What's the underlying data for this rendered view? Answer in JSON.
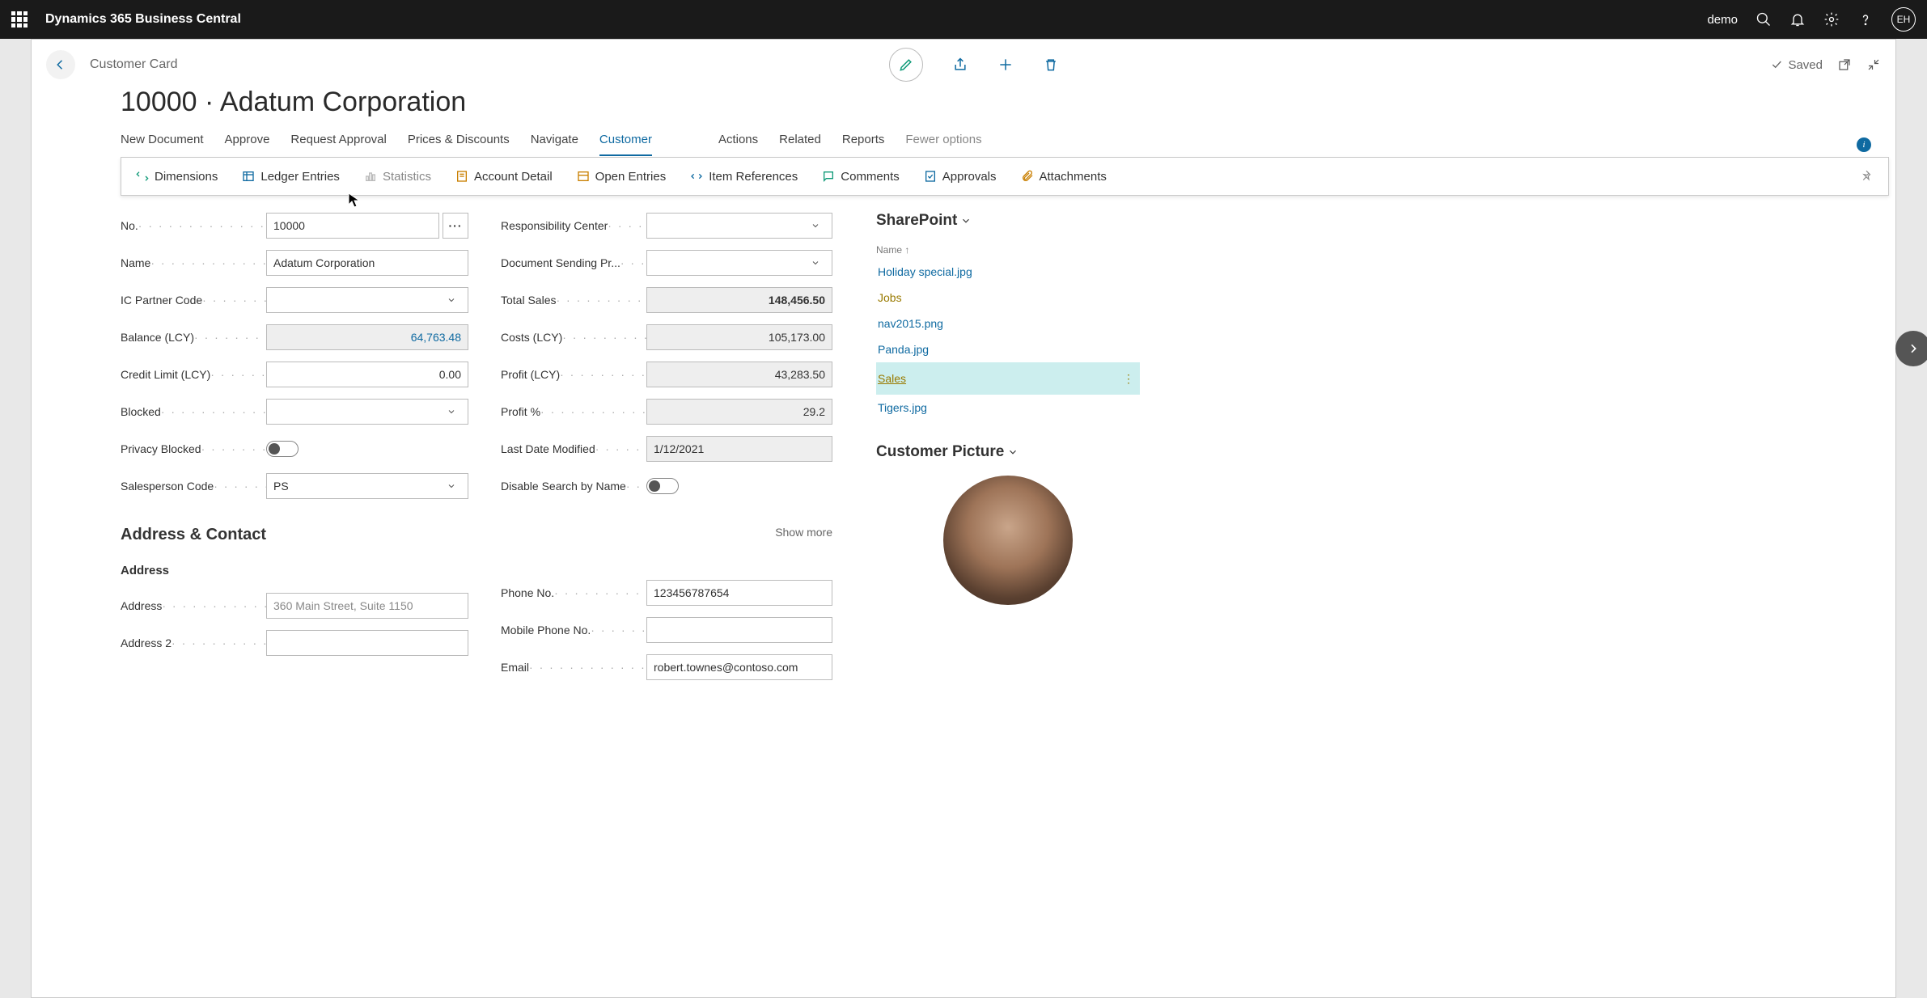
{
  "topbar": {
    "title": "Dynamics 365 Business Central",
    "user_label": "demo",
    "avatar_initials": "EH"
  },
  "header": {
    "breadcrumb": "Customer Card",
    "title": "10000 · Adatum Corporation",
    "saved_label": "Saved"
  },
  "actions": {
    "primary": [
      "New Document",
      "Approve",
      "Request Approval",
      "Prices & Discounts",
      "Navigate",
      "Customer"
    ],
    "secondary": [
      "Actions",
      "Related",
      "Reports"
    ],
    "fewer": "Fewer options"
  },
  "subactions": [
    "Dimensions",
    "Ledger Entries",
    "Statistics",
    "Account Detail",
    "Open Entries",
    "Item References",
    "Comments",
    "Approvals",
    "Attachments"
  ],
  "fields_left": {
    "no": {
      "label": "No.",
      "value": "10000"
    },
    "name": {
      "label": "Name",
      "value": "Adatum Corporation"
    },
    "ic_partner": {
      "label": "IC Partner Code",
      "value": ""
    },
    "balance": {
      "label": "Balance (LCY)",
      "value": "64,763.48"
    },
    "credit_limit": {
      "label": "Credit Limit (LCY)",
      "value": "0.00"
    },
    "blocked": {
      "label": "Blocked",
      "value": ""
    },
    "privacy": {
      "label": "Privacy Blocked"
    },
    "salesperson": {
      "label": "Salesperson Code",
      "value": "PS"
    }
  },
  "fields_right": {
    "resp_center": {
      "label": "Responsibility Center",
      "value": ""
    },
    "doc_send": {
      "label": "Document Sending Pr...",
      "value": ""
    },
    "total_sales": {
      "label": "Total Sales",
      "value": "148,456.50"
    },
    "costs": {
      "label": "Costs (LCY)",
      "value": "105,173.00"
    },
    "profit": {
      "label": "Profit (LCY)",
      "value": "43,283.50"
    },
    "profit_pct": {
      "label": "Profit %",
      "value": "29.2"
    },
    "last_modified": {
      "label": "Last Date Modified",
      "value": "1/12/2021"
    },
    "disable_search": {
      "label": "Disable Search by Name"
    }
  },
  "section_address": {
    "title": "Address & Contact",
    "show_more": "Show more",
    "subhead": "Address",
    "address": {
      "label": "Address",
      "value": "360 Main Street, Suite 1150"
    },
    "address2": {
      "label": "Address 2",
      "value": ""
    },
    "phone": {
      "label": "Phone No.",
      "value": "123456787654"
    },
    "mobile": {
      "label": "Mobile Phone No.",
      "value": ""
    },
    "email": {
      "label": "Email",
      "value": "robert.townes@contoso.com"
    }
  },
  "factbox": {
    "sharepoint": {
      "title": "SharePoint",
      "col_name": "Name ↑",
      "items": [
        {
          "label": "Holiday special.jpg",
          "type": "file"
        },
        {
          "label": "Jobs",
          "type": "folder"
        },
        {
          "label": "nav2015.png",
          "type": "file"
        },
        {
          "label": "Panda.jpg",
          "type": "file"
        },
        {
          "label": "Sales",
          "type": "folder",
          "selected": true
        },
        {
          "label": "Tigers.jpg",
          "type": "file"
        }
      ]
    },
    "picture": {
      "title": "Customer Picture"
    }
  }
}
